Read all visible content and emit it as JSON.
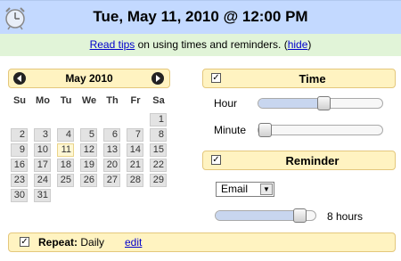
{
  "header": {
    "title": "Tue, May 11, 2010 @ 12:00 PM",
    "icon": "alarm-clock-icon"
  },
  "tips": {
    "link_label": "Read tips",
    "text": " on using times and reminders.  (",
    "hide_label": "hide",
    "close_paren": ")"
  },
  "calendar": {
    "month_label": "May 2010",
    "weekdays": [
      "Su",
      "Mo",
      "Tu",
      "We",
      "Th",
      "Fr",
      "Sa"
    ],
    "days": [
      "1",
      "2",
      "3",
      "4",
      "5",
      "6",
      "7",
      "8",
      "9",
      "10",
      "11",
      "12",
      "13",
      "14",
      "15",
      "16",
      "17",
      "18",
      "19",
      "20",
      "21",
      "22",
      "23",
      "24",
      "25",
      "26",
      "27",
      "28",
      "29",
      "30",
      "31"
    ],
    "first_weekday_index": 6,
    "today": "11"
  },
  "time_panel": {
    "title": "Time",
    "checked": "✓",
    "hour_label": "Hour",
    "hour_value_fraction": 0.53,
    "minute_label": "Minute",
    "minute_value_fraction": 0.0
  },
  "reminder_panel": {
    "title": "Reminder",
    "checked": "✓",
    "method": "Email",
    "amount_label": "8 hours",
    "amount_value_fraction": 0.9
  },
  "repeat": {
    "label": "Repeat:",
    "value": " Daily",
    "edit_label": "edit",
    "checked": "✓"
  },
  "colors": {
    "header_bg": "#c3d9ff",
    "tips_bg": "#e1f4d8",
    "panel_bg": "#fff3c1",
    "link": "#0000cc"
  }
}
